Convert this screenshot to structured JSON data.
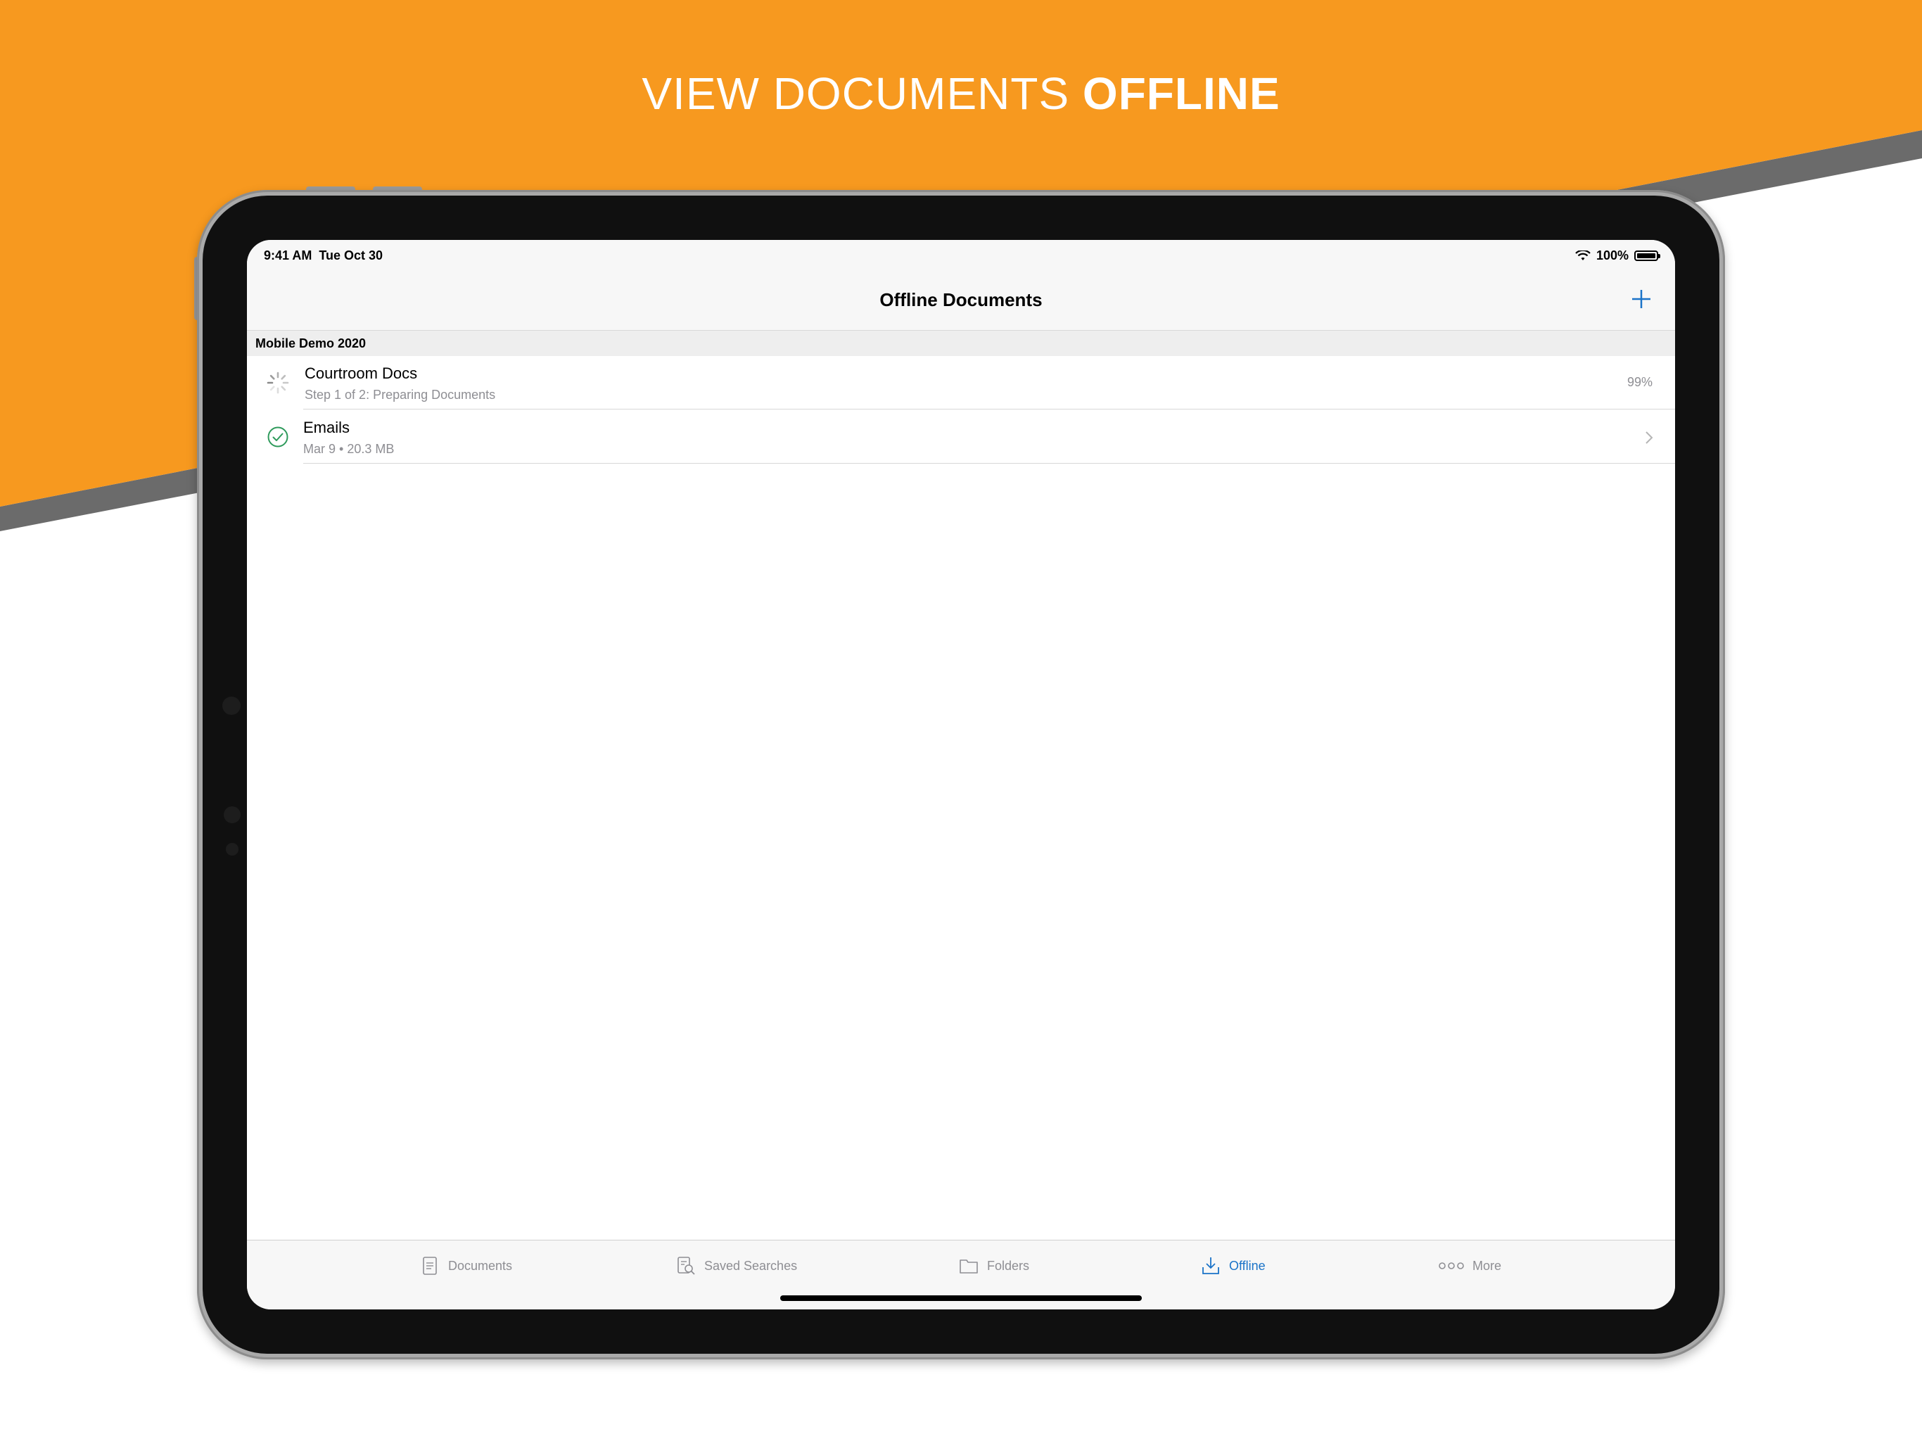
{
  "headline": {
    "regular": "VIEW DOCUMENTS ",
    "bold": "OFFLINE"
  },
  "colors": {
    "banner_orange": "#f7991f",
    "stripe_gray": "#6b6b6b",
    "accent_blue": "#1a73c8",
    "check_green": "#2e9a5b"
  },
  "status_bar": {
    "time_date": "9:41 AM  Tue Oct 30",
    "battery": "100%",
    "icons": [
      "wifi-icon",
      "battery-icon"
    ]
  },
  "nav": {
    "title": "Offline Documents",
    "add_icon": "plus-icon"
  },
  "section": {
    "header": "Mobile Demo 2020",
    "rows": [
      {
        "title": "Courtroom Docs",
        "subtitle": "Step 1 of 2: Preparing Documents",
        "progress_label": "99%",
        "progress": 0.99,
        "icon": "spinner-icon"
      },
      {
        "title": "Emails",
        "subtitle": "Mar 9 • 20.3 MB",
        "icon": "checkmark-circle-icon",
        "accessory": "chevron-right-icon"
      }
    ]
  },
  "tabs": [
    {
      "label": "Documents",
      "icon": "document-icon",
      "active": false
    },
    {
      "label": "Saved Searches",
      "icon": "saved-search-icon",
      "active": false
    },
    {
      "label": "Folders",
      "icon": "folder-icon",
      "active": false
    },
    {
      "label": "Offline",
      "icon": "download-icon",
      "active": true
    },
    {
      "label": "More",
      "icon": "more-icon",
      "active": false
    }
  ]
}
